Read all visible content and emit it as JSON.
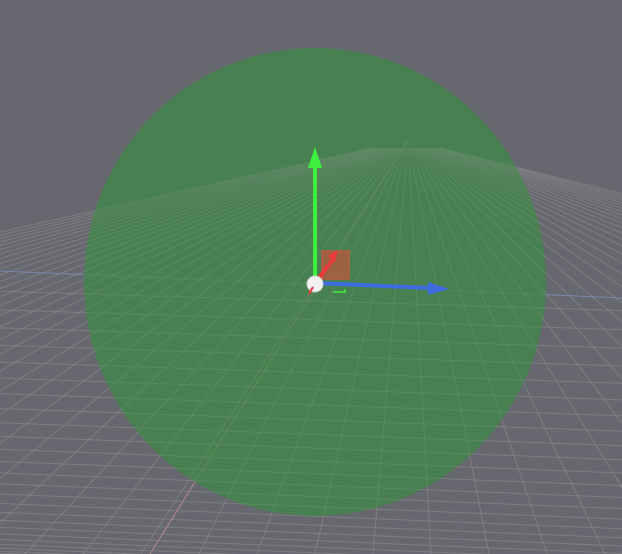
{
  "scene": {
    "background_color": "#67676f",
    "grid_color": "#8a8a90",
    "horizon_line_color": "#7d8fc0",
    "depth_line_color": "#c58f8f",
    "sphere": {
      "color": "#3f8a45",
      "opacity": 0.72
    }
  },
  "gizmo": {
    "mode": "translate",
    "y_axis_color": "#3ef03e",
    "z_axis_color": "#3d6be0",
    "x_axis_color": "#e83a3a",
    "plane_handle_color": "#e0503a",
    "center_color": "#f2f2f2"
  },
  "icons": {
    "translate_gizmo": "move-gizmo-icon",
    "pivot": "pivot-point-icon"
  }
}
